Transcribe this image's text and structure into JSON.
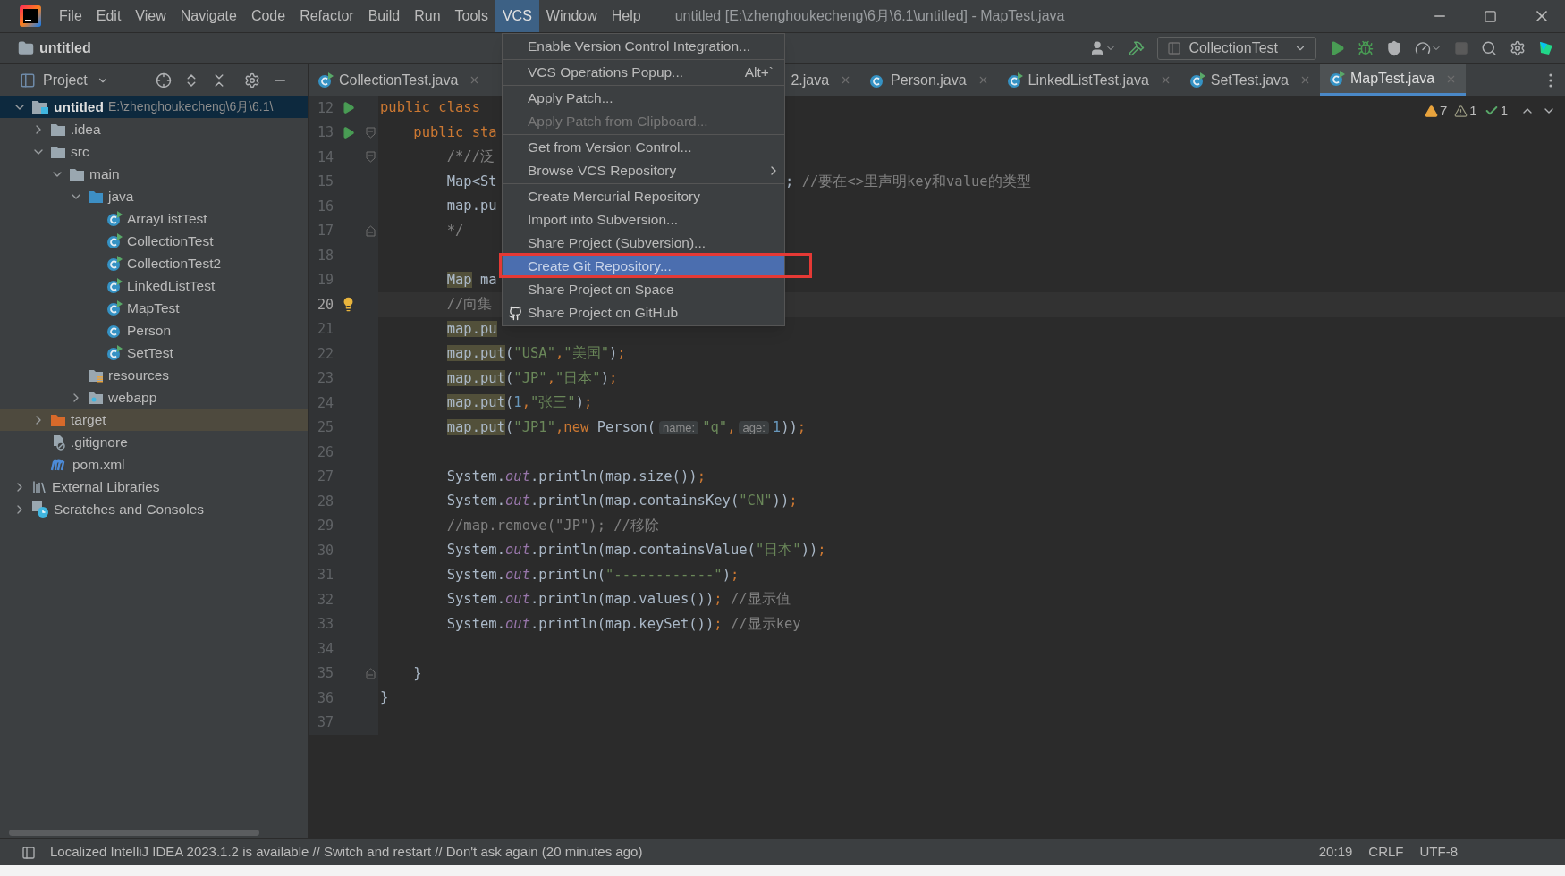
{
  "window": {
    "title": "untitled [E:\\zhenghoukecheng\\6月\\6.1\\untitled] - MapTest.java",
    "menus": [
      {
        "label": "File",
        "selected": false
      },
      {
        "label": "Edit",
        "selected": false
      },
      {
        "label": "View",
        "selected": false
      },
      {
        "label": "Navigate",
        "selected": false
      },
      {
        "label": "Code",
        "selected": false
      },
      {
        "label": "Refactor",
        "selected": false
      },
      {
        "label": "Build",
        "selected": false
      },
      {
        "label": "Run",
        "selected": false
      },
      {
        "label": "Tools",
        "selected": false
      },
      {
        "label": "VCS",
        "selected": true
      },
      {
        "label": "Window",
        "selected": false
      },
      {
        "label": "Help",
        "selected": false
      }
    ]
  },
  "navbar": {
    "project": "untitled",
    "run_config": "CollectionTest"
  },
  "project_panel": {
    "title": "Project",
    "tree": [
      {
        "name": "untitled",
        "path": "E:\\zhenghoukecheng\\6月\\6.1\\",
        "kind": "module",
        "selected": true,
        "hovered": false,
        "expanded": true,
        "children": [
          {
            "name": ".idea",
            "kind": "folder",
            "selected": false,
            "hovered": false,
            "expanded": false
          },
          {
            "name": "src",
            "kind": "folder",
            "selected": false,
            "hovered": false,
            "expanded": true,
            "children": [
              {
                "name": "main",
                "kind": "folder",
                "selected": false,
                "hovered": false,
                "expanded": true,
                "children": [
                  {
                    "name": "java",
                    "kind": "source-folder",
                    "selected": false,
                    "hovered": false,
                    "expanded": true,
                    "children": [
                      {
                        "name": "ArrayListTest",
                        "kind": "class-runnable",
                        "selected": false,
                        "hovered": false
                      },
                      {
                        "name": "CollectionTest",
                        "kind": "class-runnable",
                        "selected": false,
                        "hovered": false
                      },
                      {
                        "name": "CollectionTest2",
                        "kind": "class-runnable",
                        "selected": false,
                        "hovered": false
                      },
                      {
                        "name": "LinkedListTest",
                        "kind": "class-runnable",
                        "selected": false,
                        "hovered": false
                      },
                      {
                        "name": "MapTest",
                        "kind": "class-runnable",
                        "selected": false,
                        "hovered": false
                      },
                      {
                        "name": "Person",
                        "kind": "class",
                        "selected": false,
                        "hovered": false
                      },
                      {
                        "name": "SetTest",
                        "kind": "class-runnable",
                        "selected": false,
                        "hovered": false
                      }
                    ]
                  },
                  {
                    "name": "resources",
                    "kind": "resources-folder",
                    "selected": false,
                    "hovered": false
                  },
                  {
                    "name": "webapp",
                    "kind": "web-folder",
                    "selected": false,
                    "hovered": false,
                    "expanded": false
                  }
                ]
              }
            ]
          },
          {
            "name": "target",
            "kind": "excluded-folder",
            "selected": false,
            "hovered": true,
            "expanded": false
          },
          {
            "name": ".gitignore",
            "kind": "ignore-file",
            "selected": false,
            "hovered": false
          },
          {
            "name": "pom.xml",
            "kind": "maven",
            "selected": false,
            "hovered": false
          }
        ]
      },
      {
        "name": "External Libraries",
        "kind": "libraries",
        "selected": false,
        "hovered": false,
        "expanded": false
      },
      {
        "name": "Scratches and Consoles",
        "kind": "scratches",
        "selected": false,
        "hovered": false,
        "expanded": false
      }
    ]
  },
  "editor": {
    "tabs": [
      {
        "label": "CollectionTest.java",
        "kind": "class-runnable",
        "selected": false,
        "partly_hidden": false
      },
      {
        "label": "2.java",
        "kind": "hidden-icon",
        "selected": false,
        "partly_hidden": true
      },
      {
        "label": "Person.java",
        "kind": "class",
        "selected": false,
        "partly_hidden": false
      },
      {
        "label": "LinkedListTest.java",
        "kind": "class-runnable",
        "selected": false,
        "partly_hidden": false
      },
      {
        "label": "SetTest.java",
        "kind": "class-runnable",
        "selected": false,
        "partly_hidden": false
      },
      {
        "label": "MapTest.java",
        "kind": "class-runnable",
        "selected": true,
        "partly_hidden": false
      }
    ],
    "inspections": {
      "warnings": "7",
      "weak_warnings": "1",
      "passed": "1"
    },
    "lines": [
      {
        "number": "12",
        "current": false,
        "gutter": {
          "kind": "run"
        },
        "tokens": [
          {
            "kind": "kw",
            "text": "public class"
          }
        ]
      },
      {
        "number": "13",
        "current": false,
        "gutter": {
          "kind": "run"
        },
        "fold": {
          "kind": "open"
        },
        "tokens": [
          {
            "kind": "kw",
            "text": "    public sta"
          }
        ]
      },
      {
        "number": "14",
        "current": false,
        "fold": {
          "kind": "open"
        },
        "tokens": [
          {
            "kind": "cmt",
            "text": "        /*//泛"
          }
        ]
      },
      {
        "number": "15",
        "current": false,
        "tokens": [
          {
            "kind": "plain",
            "text": "        Map<St"
          }
        ],
        "after": [
          {
            "kind": "plain",
            "text": "; "
          },
          {
            "kind": "cmt",
            "text": "//要在<>里声明key和value的类型"
          }
        ]
      },
      {
        "number": "16",
        "current": false,
        "tokens": [
          {
            "kind": "plain",
            "text": "        map.pu"
          }
        ]
      },
      {
        "number": "17",
        "current": false,
        "fold": {
          "kind": "close"
        },
        "tokens": [
          {
            "kind": "cmt",
            "text": "        */"
          }
        ]
      },
      {
        "number": "18",
        "current": false
      },
      {
        "number": "19",
        "current": false,
        "tokens": [
          {
            "kind": "hl",
            "text": "        Map"
          },
          {
            "kind": "plain",
            "text": " ma"
          }
        ]
      },
      {
        "number": "20",
        "current": true,
        "gutter": {
          "kind": "bulb"
        },
        "tokens": [
          {
            "kind": "cmt",
            "text": "        //向集"
          }
        ]
      },
      {
        "number": "21",
        "current": false,
        "tokens": [
          {
            "kind": "hl",
            "text": "        map.pu"
          }
        ]
      },
      {
        "number": "22",
        "current": false,
        "tokens": [
          {
            "kind": "hl",
            "text": "        map.put"
          },
          {
            "kind": "plain",
            "text": "("
          },
          {
            "kind": "str",
            "text": "\"USA\""
          },
          {
            "kind": "kw",
            "text": ","
          },
          {
            "kind": "str",
            "text": "\"美国\""
          },
          {
            "kind": "plain",
            "text": ")"
          },
          {
            "kind": "kw",
            "text": ";"
          }
        ]
      },
      {
        "number": "23",
        "current": false,
        "tokens": [
          {
            "kind": "hl",
            "text": "        map.put"
          },
          {
            "kind": "plain",
            "text": "("
          },
          {
            "kind": "str",
            "text": "\"JP\""
          },
          {
            "kind": "kw",
            "text": ","
          },
          {
            "kind": "str",
            "text": "\"日本\""
          },
          {
            "kind": "plain",
            "text": ")"
          },
          {
            "kind": "kw",
            "text": ";"
          }
        ]
      },
      {
        "number": "24",
        "current": false,
        "tokens": [
          {
            "kind": "hl",
            "text": "        map.put"
          },
          {
            "kind": "plain",
            "text": "("
          },
          {
            "kind": "num",
            "text": "1"
          },
          {
            "kind": "kw",
            "text": ","
          },
          {
            "kind": "str",
            "text": "\"张三\""
          },
          {
            "kind": "plain",
            "text": ")"
          },
          {
            "kind": "kw",
            "text": ";"
          }
        ]
      },
      {
        "number": "25",
        "current": false,
        "tokens": [
          {
            "kind": "hl",
            "text": "        map.put"
          },
          {
            "kind": "plain",
            "text": "("
          },
          {
            "kind": "str",
            "text": "\"JP1\""
          },
          {
            "kind": "kw",
            "text": ",new "
          },
          {
            "kind": "plain",
            "text": "Person("
          },
          {
            "kind": "hint",
            "text": "name:"
          },
          {
            "kind": "str",
            "text": "\"q\""
          },
          {
            "kind": "kw",
            "text": ","
          },
          {
            "kind": "hint",
            "text": "age:"
          },
          {
            "kind": "num",
            "text": "1"
          },
          {
            "kind": "plain",
            "text": "))"
          },
          {
            "kind": "kw",
            "text": ";"
          }
        ]
      },
      {
        "number": "26",
        "current": false
      },
      {
        "number": "27",
        "current": false,
        "tokens": [
          {
            "kind": "plain",
            "text": "        System."
          },
          {
            "kind": "field",
            "text": "out"
          },
          {
            "kind": "plain",
            "text": ".println(map.size())"
          },
          {
            "kind": "kw",
            "text": ";"
          }
        ]
      },
      {
        "number": "28",
        "current": false,
        "tokens": [
          {
            "kind": "plain",
            "text": "        System."
          },
          {
            "kind": "field",
            "text": "out"
          },
          {
            "kind": "plain",
            "text": ".println(map.containsKey("
          },
          {
            "kind": "str",
            "text": "\"CN\""
          },
          {
            "kind": "plain",
            "text": "))"
          },
          {
            "kind": "kw",
            "text": ";"
          }
        ]
      },
      {
        "number": "29",
        "current": false,
        "tokens": [
          {
            "kind": "cmt",
            "text": "        //map.remove(\"JP\"); //移除"
          }
        ]
      },
      {
        "number": "30",
        "current": false,
        "tokens": [
          {
            "kind": "plain",
            "text": "        System."
          },
          {
            "kind": "field",
            "text": "out"
          },
          {
            "kind": "plain",
            "text": ".println(map.containsValue("
          },
          {
            "kind": "str",
            "text": "\"日本\""
          },
          {
            "kind": "plain",
            "text": "))"
          },
          {
            "kind": "kw",
            "text": ";"
          }
        ]
      },
      {
        "number": "31",
        "current": false,
        "tokens": [
          {
            "kind": "plain",
            "text": "        System."
          },
          {
            "kind": "field",
            "text": "out"
          },
          {
            "kind": "plain",
            "text": ".println("
          },
          {
            "kind": "str",
            "text": "\"------------\""
          },
          {
            "kind": "plain",
            "text": ")"
          },
          {
            "kind": "kw",
            "text": ";"
          }
        ]
      },
      {
        "number": "32",
        "current": false,
        "tokens": [
          {
            "kind": "plain",
            "text": "        System."
          },
          {
            "kind": "field",
            "text": "out"
          },
          {
            "kind": "plain",
            "text": ".println(map.values())"
          },
          {
            "kind": "kw",
            "text": "; "
          },
          {
            "kind": "cmt",
            "text": "//显示值"
          }
        ]
      },
      {
        "number": "33",
        "current": false,
        "tokens": [
          {
            "kind": "plain",
            "text": "        System."
          },
          {
            "kind": "field",
            "text": "out"
          },
          {
            "kind": "plain",
            "text": ".println(map.keySet())"
          },
          {
            "kind": "kw",
            "text": "; "
          },
          {
            "kind": "cmt",
            "text": "//显示key"
          }
        ]
      },
      {
        "number": "34",
        "current": false
      },
      {
        "number": "35",
        "current": false,
        "fold": {
          "kind": "close"
        },
        "tokens": [
          {
            "kind": "plain",
            "text": "    }"
          }
        ]
      },
      {
        "number": "36",
        "current": false,
        "tokens": [
          {
            "kind": "plain",
            "text": "}"
          }
        ]
      },
      {
        "number": "37",
        "current": false
      }
    ]
  },
  "vcs_menu": {
    "groups": [
      [
        {
          "label": "Enable Version Control Integration...",
          "kind": "plain",
          "disabled": false,
          "selected": false,
          "submenu": false
        }
      ],
      [
        {
          "label": "VCS Operations Popup...",
          "shortcut": "Alt+`",
          "kind": "plain",
          "disabled": false,
          "selected": false,
          "submenu": false
        }
      ],
      [
        {
          "label": "Apply Patch...",
          "kind": "plain",
          "disabled": false,
          "selected": false,
          "submenu": false
        },
        {
          "label": "Apply Patch from Clipboard...",
          "kind": "plain",
          "disabled": true,
          "selected": false,
          "submenu": false
        }
      ],
      [
        {
          "label": "Get from Version Control...",
          "kind": "plain",
          "disabled": false,
          "selected": false,
          "submenu": false
        },
        {
          "label": "Browse VCS Repository",
          "kind": "plain",
          "disabled": false,
          "selected": false,
          "submenu": true
        }
      ],
      [
        {
          "label": "Create Mercurial Repository",
          "kind": "plain",
          "disabled": false,
          "selected": false,
          "submenu": false
        },
        {
          "label": "Import into Subversion...",
          "kind": "plain",
          "disabled": false,
          "selected": false,
          "submenu": false
        },
        {
          "label": "Share Project (Subversion)...",
          "kind": "plain",
          "disabled": false,
          "selected": false,
          "submenu": false
        },
        {
          "label": "Create Git Repository...",
          "kind": "plain",
          "disabled": false,
          "selected": true,
          "submenu": false
        },
        {
          "label": "Share Project on Space",
          "kind": "plain",
          "disabled": false,
          "selected": false,
          "submenu": false
        },
        {
          "label": "Share Project on GitHub",
          "kind": "github",
          "disabled": false,
          "selected": false,
          "submenu": false
        }
      ]
    ]
  },
  "status_bar": {
    "message": "Localized IntelliJ IDEA 2023.1.2 is available // Switch and restart // Don't ask again (20 minutes ago)",
    "position": "20:19",
    "line_separator": "CRLF",
    "encoding": "UTF-8"
  }
}
